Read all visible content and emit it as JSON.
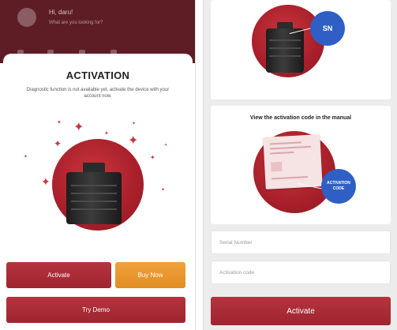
{
  "colors": {
    "brand_red": "#a82632",
    "accent_orange": "#e8952e",
    "badge_blue": "#2f5fc4"
  },
  "left_screen": {
    "header": {
      "greeting": "Hi, daru!",
      "subtitle": "What are you looking for?"
    },
    "activation": {
      "title": "ACTIVATION",
      "description": "Diagnostic function is not available yet, activate the device with your account now.",
      "activate_button": "Activate",
      "buy_now_button": "Buy Now",
      "try_demo_button": "Try Demo"
    }
  },
  "right_screen": {
    "sn_badge": "SN",
    "manual_card": {
      "title": "View the activation code in the manual",
      "badge": "ACTIVATION CODE"
    },
    "serial_number_field": {
      "placeholder": "Serial Number",
      "value": ""
    },
    "activation_code_field": {
      "placeholder": "Activation code",
      "value": ""
    },
    "activate_button": "Activate"
  }
}
